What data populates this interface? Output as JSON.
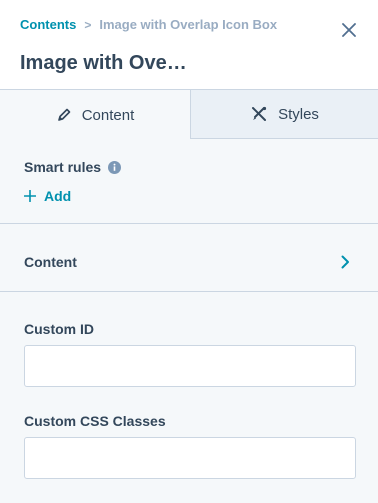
{
  "breadcrumb": {
    "parent": "Contents",
    "separator": ">",
    "current": "Image with Overlap Icon Box"
  },
  "title": "Image with Ove…",
  "tabs": [
    {
      "label": "Content",
      "icon": "pencil-icon",
      "active": true
    },
    {
      "label": "Styles",
      "icon": "brush-tools-icon",
      "active": false
    }
  ],
  "smart_rules": {
    "label": "Smart rules",
    "add_label": "Add"
  },
  "content_section": {
    "label": "Content"
  },
  "custom_id": {
    "label": "Custom ID",
    "value": ""
  },
  "custom_css": {
    "label": "Custom CSS Classes",
    "value": ""
  },
  "colors": {
    "accent": "#0091ae",
    "text": "#33475b",
    "muted": "#99acc2",
    "border": "#cbd6e2"
  }
}
